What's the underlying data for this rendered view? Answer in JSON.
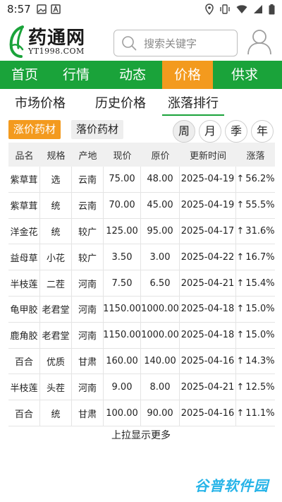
{
  "status": {
    "time": "8:57"
  },
  "header": {
    "logo_name": "药通网",
    "logo_domain": "YT1998.COM",
    "search_placeholder": "搜索关键字"
  },
  "nav": [
    {
      "label": "首页",
      "active": false
    },
    {
      "label": "行情",
      "active": false
    },
    {
      "label": "动态",
      "active": false
    },
    {
      "label": "价格",
      "active": true
    },
    {
      "label": "供求",
      "active": false
    }
  ],
  "sub_tabs": [
    {
      "label": "市场价格",
      "active": false
    },
    {
      "label": "历史价格",
      "active": false
    },
    {
      "label": "涨落排行",
      "active": true
    }
  ],
  "filters": {
    "rise_label": "涨价药材",
    "fall_label": "落价药材",
    "periods": [
      "周",
      "月",
      "季",
      "年"
    ],
    "active_period": "周"
  },
  "table": {
    "headers": [
      "品名",
      "规格",
      "产地",
      "现价",
      "原价",
      "更新时间",
      "涨落"
    ],
    "rows": [
      [
        "紫草茸",
        "选",
        "云南",
        "75.00",
        "48.00",
        "2025-04-19",
        "56.2%"
      ],
      [
        "紫草茸",
        "统",
        "云南",
        "70.00",
        "45.00",
        "2025-04-19",
        "55.5%"
      ],
      [
        "洋金花",
        "统",
        "较广",
        "125.00",
        "95.00",
        "2025-04-17",
        "31.6%"
      ],
      [
        "益母草",
        "小花",
        "较广",
        "3.50",
        "3.00",
        "2025-04-22",
        "16.7%"
      ],
      [
        "半枝莲",
        "二茬",
        "河南",
        "7.50",
        "6.50",
        "2025-04-21",
        "15.4%"
      ],
      [
        "龟甲胶",
        "老君堂",
        "河南",
        "1150.00",
        "1000.00",
        "2025-04-18",
        "15.0%"
      ],
      [
        "鹿角胶",
        "老君堂",
        "河南",
        "1150.00",
        "1000.00",
        "2025-04-18",
        "15.0%"
      ],
      [
        "百合",
        "优质",
        "甘肃",
        "160.00",
        "140.00",
        "2025-04-16",
        "14.3%"
      ],
      [
        "半枝莲",
        "头茬",
        "河南",
        "9.00",
        "8.00",
        "2025-04-21",
        "12.5%"
      ],
      [
        "百合",
        "统",
        "甘肃",
        "100.00",
        "90.00",
        "2025-04-16",
        "11.1%"
      ]
    ]
  },
  "load_more": "上拉显示更多",
  "watermark": "谷普软件园",
  "colors": {
    "primary_green": "#1aa33a",
    "accent_orange": "#f39a1e",
    "watermark_blue": "#27b4e8"
  }
}
